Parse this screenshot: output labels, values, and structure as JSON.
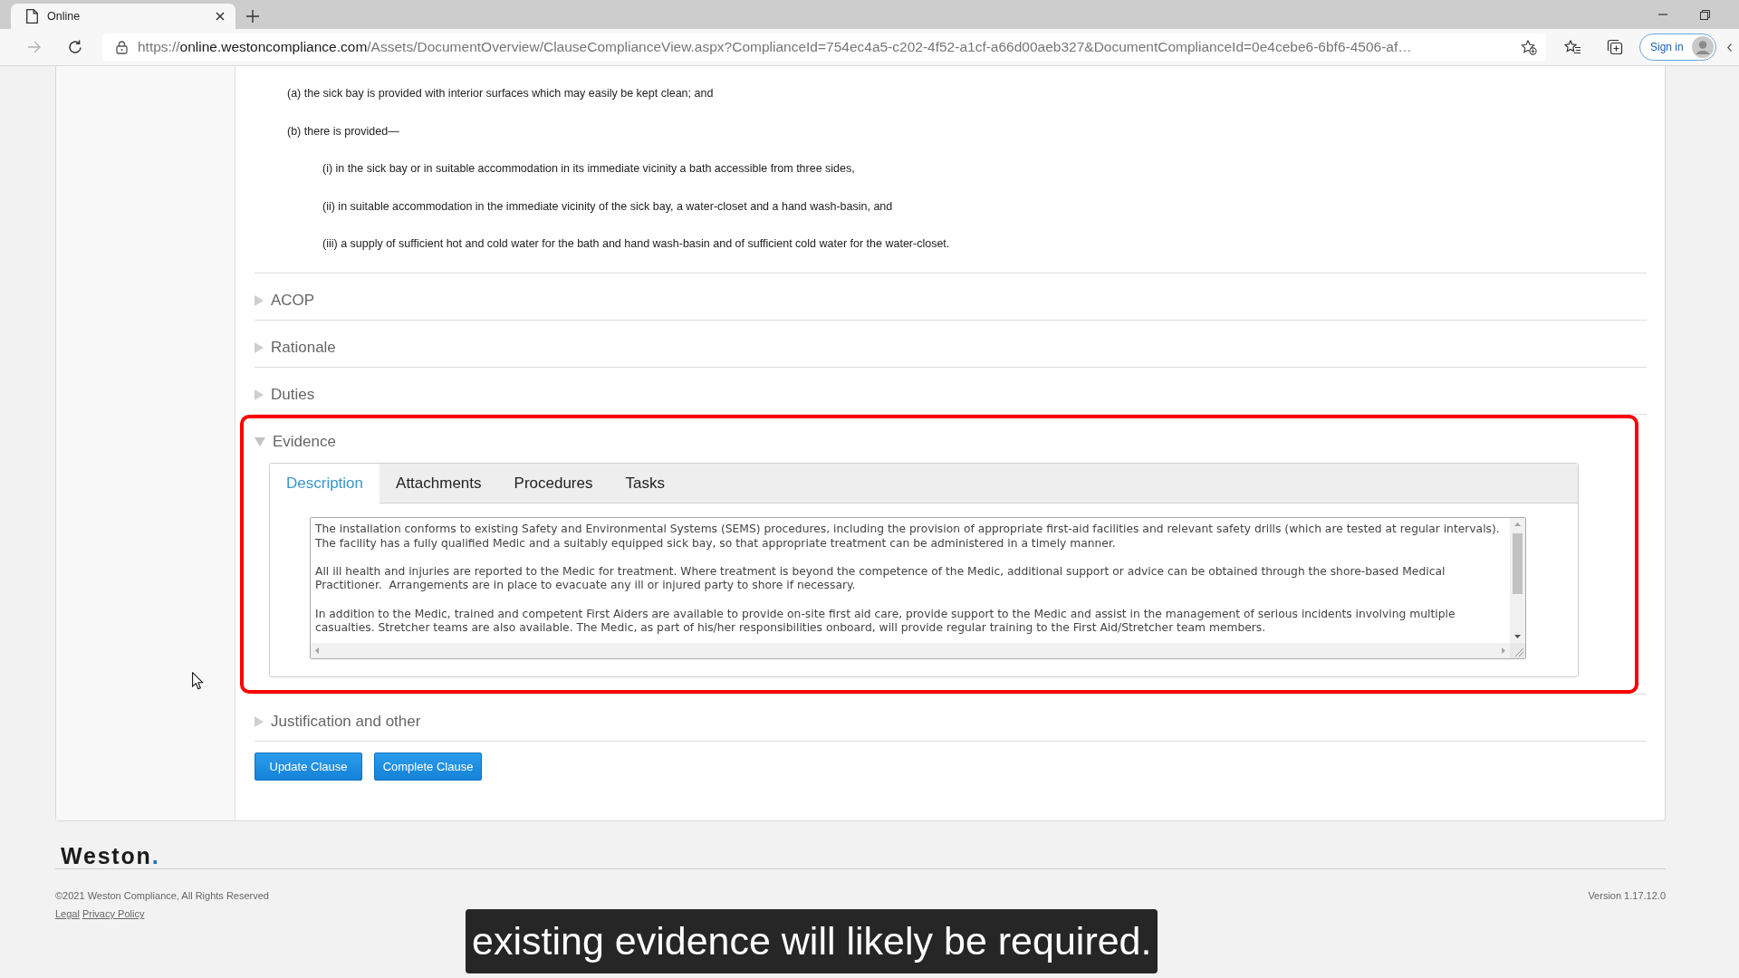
{
  "browser": {
    "tabs": [
      {
        "title": "Online",
        "selected": true
      }
    ],
    "forward_disabled": true,
    "url": {
      "scheme": "https://",
      "host": "online.westoncompliance.com",
      "rest": "/Assets/DocumentOverview/ClauseComplianceView.aspx?ComplianceId=754ec4a5-c202-4f52-a1cf-a66d00aeb327&DocumentComplianceId=0e4cebe6-6bf6-4506-af…"
    },
    "sign_in": "Sign in"
  },
  "clause": {
    "items": [
      {
        "text": "(a) the sick bay is provided with interior surfaces which may easily be kept clean; and"
      },
      {
        "text": "(b) there is provided—",
        "children": [
          {
            "text": "(i) in the sick bay or in suitable accommodation in its immediate vicinity a bath accessible from three sides,"
          },
          {
            "text": "(ii) in suitable accommodation in the immediate vicinity of the sick bay, a water-closet and a hand wash-basin, and"
          },
          {
            "text": "(iii) a supply of sufficient hot and cold water for the bath and hand wash-basin and of sufficient cold water for the water-closet."
          }
        ]
      }
    ]
  },
  "sections": [
    {
      "title": "ACOP",
      "expanded": false,
      "highlighted": false
    },
    {
      "title": "Rationale",
      "expanded": false,
      "highlighted": false
    },
    {
      "title": "Duties",
      "expanded": false,
      "highlighted": false
    },
    {
      "title": "Evidence",
      "expanded": true,
      "highlighted": true,
      "tabs": [
        {
          "label": "Description",
          "selected": true
        },
        {
          "label": "Attachments",
          "selected": false
        },
        {
          "label": "Procedures",
          "selected": false
        },
        {
          "label": "Tasks",
          "selected": false
        }
      ],
      "description": {
        "paragraphs": [
          [
            "The installation conforms to existing Safety and Environmental Systems (SEMS) procedures, including the provision of appropriate first-aid facilities and relevant safety drills (which are tested at regular intervals).",
            "The facility has a fully qualified Medic and a suitably equipped sick bay, so that appropriate treatment can be administered in a timely manner."
          ],
          [
            "All ill health and injuries are reported to the Medic for treatment. Where treatment is beyond the competence of the Medic, additional support or advice can be obtained through the shore-based Medical",
            "Practitioner.  Arrangements are in place to evacuate any ill or injured party to shore if necessary."
          ],
          [
            "In addition to the Medic, trained and competent First Aiders are available to provide on-site first aid care, provide support to the Medic and assist in the management of serious incidents involving multiple",
            "casualties. Stretcher teams are also available. The Medic, as part of his/her responsibilities onboard, will provide regular training to the First Aid/Stretcher team members."
          ]
        ]
      }
    },
    {
      "title": "Justification and other",
      "expanded": false,
      "highlighted": false
    }
  ],
  "buttons": [
    {
      "label": "Update Clause"
    },
    {
      "label": "Complete Clause"
    }
  ],
  "footer": {
    "logo": "Weston.",
    "copyright": "©2021 Weston Compliance, All Rights Reserved",
    "links": [
      "Legal",
      "Privacy Policy"
    ],
    "version": "Version 1.17.12.0"
  },
  "caption": "existing evidence will likely be required."
}
